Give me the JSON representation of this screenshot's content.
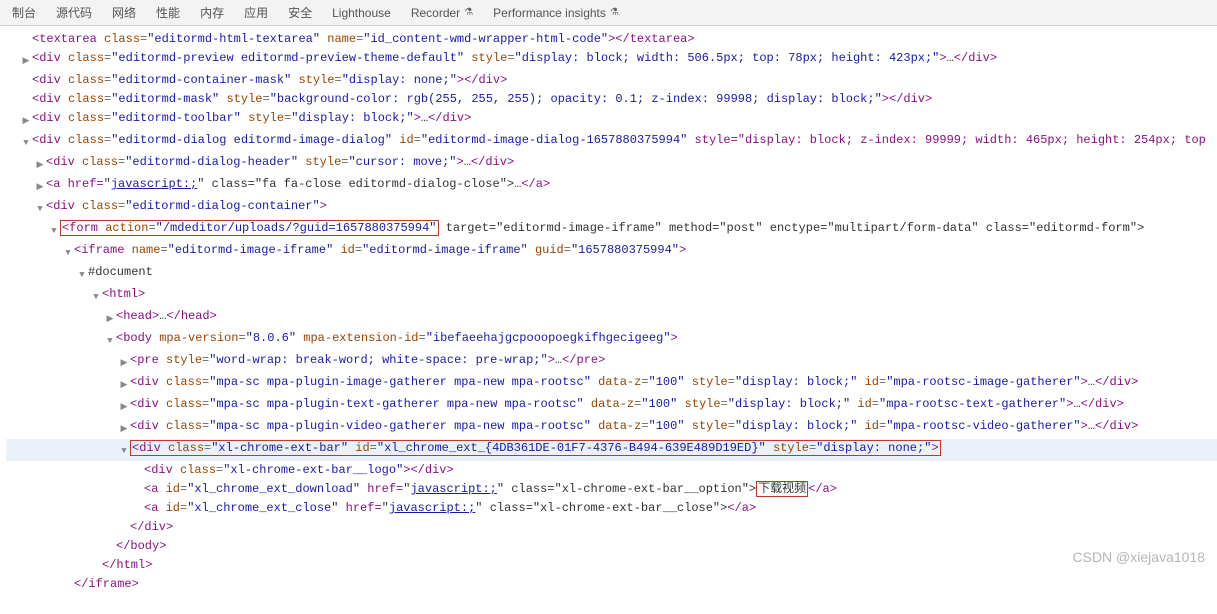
{
  "tabs": {
    "console": "制台",
    "sources": "源代码",
    "network": "网络",
    "performance": "性能",
    "memory": "内存",
    "application": "应用",
    "security": "安全",
    "lighthouse": "Lighthouse",
    "recorder": "Recorder",
    "insights": "Performance insights"
  },
  "lines": {
    "l1": "<textarea class=\"editormd-html-textarea\" name=\"id_content-wmd-wrapper-html-code\"></textarea>",
    "l2": "<div class=\"editormd-preview editormd-preview-theme-default\" style=\"display: block; width: 506.5px; top: 78px; height: 423px;\">…</div>",
    "l3": "<div class=\"editormd-container-mask\" style=\"display: none;\"></div>",
    "l4": "<div class=\"editormd-mask\" style=\"background-color: rgb(255, 255, 255); opacity: 0.1; z-index: 99998; display: block;\"></div>",
    "l5": "<div class=\"editormd-toolbar\" style=\"display: block;\">…</div>",
    "l6": "<div class=\"editormd-dialog editormd-image-dialog\" id=\"editormd-image-dialog-1657880375994\" style=\"display: block; z-index: 99999; width: 465px; height: 254px; top",
    "l7": "<div class=\"editormd-dialog-header\" style=\"cursor: move;\">…</div>",
    "l8_open": "<a href=",
    "l8_js": "javascript:;",
    "l8_rest": " class=\"fa fa-close editormd-dialog-close\">…</a>",
    "l9": "<div class=\"editormd-dialog-container\">",
    "l10_form_open": "<form action=\"/mdeditor/uploads/?guid=1657880375994\"",
    "l10_form_rest": " target=\"editormd-image-iframe\" method=\"post\" enctype=\"multipart/form-data\" class=\"editormd-form\">",
    "l11": "<iframe name=\"editormd-image-iframe\" id=\"editormd-image-iframe\" guid=\"1657880375994\">",
    "l12": "#document",
    "l13": "<html>",
    "l14": "<head>…</head>",
    "l15": "<body mpa-version=\"8.0.6\" mpa-extension-id=\"ibefaeehajgcpooopoegkifhgecigeeg\">",
    "l16": "<pre style=\"word-wrap: break-word; white-space: pre-wrap;\">…</pre>",
    "l17": "<div class=\"mpa-sc mpa-plugin-image-gatherer mpa-new mpa-rootsc\" data-z=\"100\" style=\"display: block;\" id=\"mpa-rootsc-image-gatherer\">…</div>",
    "l18": "<div class=\"mpa-sc mpa-plugin-text-gatherer mpa-new mpa-rootsc\" data-z=\"100\" style=\"display: block;\" id=\"mpa-rootsc-text-gatherer\">…</div>",
    "l19": "<div class=\"mpa-sc mpa-plugin-video-gatherer mpa-new mpa-rootsc\" data-z=\"100\" style=\"display: block;\" id=\"mpa-rootsc-video-gatherer\">…</div>",
    "l20": "<div class=\"xl-chrome-ext-bar\" id=\"xl_chrome_ext_{4DB361DE-01F7-4376-B494-639E489D19ED}\" style=\"display: none;\">",
    "l21": "<div class=\"xl-chrome-ext-bar__logo\"></div>",
    "l22_open": "<a id=\"xl_chrome_ext_download\" href=",
    "l22_js": "javascript:;",
    "l22_mid": " class=\"xl-chrome-ext-bar__option\">",
    "l22_text": "下载视频",
    "l22_close": "</a>",
    "l23_open": "<a id=\"xl_chrome_ext_close\" href=",
    "l23_js": "javascript:;",
    "l23_rest": " class=\"xl-chrome-ext-bar__close\"></a>",
    "l24": "</div>",
    "l25": "</body>",
    "l26": "</html>",
    "l27": "</iframe>"
  },
  "watermark": "CSDN @xiejava1018"
}
